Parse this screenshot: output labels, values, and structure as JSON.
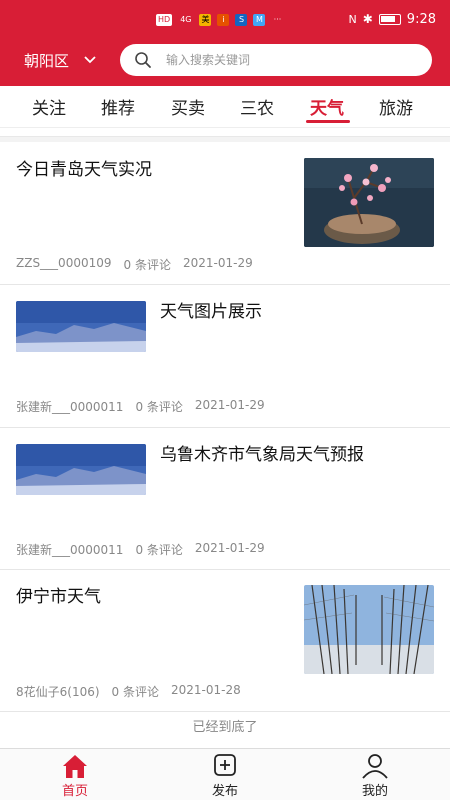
{
  "status_bar": {
    "time": "9:28",
    "left_chips": [
      "HD",
      "4G",
      "美",
      "i",
      "S",
      "M",
      "···"
    ]
  },
  "header": {
    "district": "朝阳区",
    "search_placeholder": "输入搜索关键词"
  },
  "tabs": [
    {
      "label": "关注",
      "active": false
    },
    {
      "label": "推荐",
      "active": false
    },
    {
      "label": "买卖",
      "active": false
    },
    {
      "label": "三农",
      "active": false
    },
    {
      "label": "天气",
      "active": true
    },
    {
      "label": "旅游",
      "active": false
    }
  ],
  "feed": [
    {
      "title": "今日青岛天气实况",
      "author": "ZZS___0000109",
      "comments": "0 条评论",
      "date": "2021-01-29",
      "thumb": "plum-blossom-photo"
    },
    {
      "title": "天气图片展示",
      "author": "张建新___0000011",
      "comments": "0 条评论",
      "date": "2021-01-29",
      "thumb": "snowy-mountain-photo"
    },
    {
      "title": "乌鲁木齐市气象局天气预报",
      "author": "张建新___0000011",
      "comments": "0 条评论",
      "date": "2021-01-29",
      "thumb": "snowy-mountain-photo"
    },
    {
      "title": "伊宁市天气",
      "author": "8花仙子6(106)",
      "comments": "0 条评论",
      "date": "2021-01-28",
      "thumb": "winter-trees-photo"
    }
  ],
  "end_note": "已经到底了",
  "bottom_nav": [
    {
      "label": "首页",
      "icon": "home-icon",
      "active": true
    },
    {
      "label": "发布",
      "icon": "add-square-icon",
      "active": false
    },
    {
      "label": "我的",
      "icon": "user-icon",
      "active": false
    }
  ],
  "colors": {
    "brand": "#d81e36",
    "meta": "#888888",
    "tab_active": "#d81e36"
  }
}
